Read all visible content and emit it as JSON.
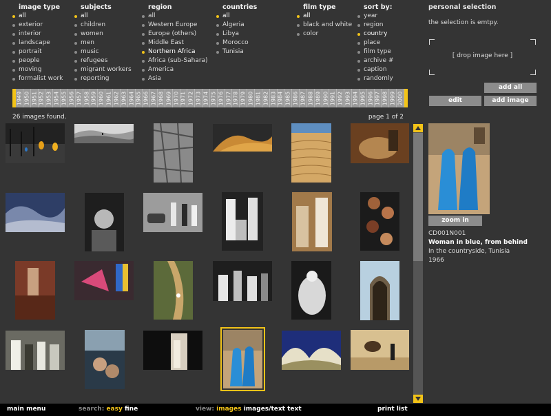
{
  "filters": [
    {
      "title": "image type",
      "items": [
        "all",
        "exterior",
        "interior",
        "landscape",
        "portrait",
        "people",
        "moving",
        "formalist work"
      ],
      "selected": [
        0
      ]
    },
    {
      "title": "subjects",
      "items": [
        "all",
        "children",
        "women",
        "men",
        "music",
        "refugees",
        "migrant workers",
        "reporting"
      ],
      "selected": [
        0
      ]
    },
    {
      "title": "region",
      "items": [
        "all",
        "Western Europe",
        "Europe (others)",
        "Middle East",
        "Northern Africa",
        "Africa (sub-Sahara)",
        "America",
        "Asia"
      ],
      "selected": [
        4
      ]
    },
    {
      "title": "countries",
      "items": [
        "all",
        "Algeria",
        "Libya",
        "Morocco",
        "Tunisia"
      ],
      "selected": [
        0
      ]
    },
    {
      "title": "film type",
      "items": [
        "all",
        "black and white",
        "color"
      ],
      "selected": [
        0
      ]
    },
    {
      "title": "sort by:",
      "items": [
        "year",
        "region",
        "country",
        "place",
        "film type",
        "archive #",
        "caption",
        "randomly"
      ],
      "selected": [
        2
      ]
    }
  ],
  "personal_selection": {
    "title": "personal selection",
    "empty_text": "the selection is emtpy.",
    "drop_label": "[ drop image here ]",
    "add_all": "add all",
    "edit": "edit",
    "add_image": "add image"
  },
  "years": [
    "1949",
    "1950",
    "1951",
    "1952",
    "1953",
    "1954",
    "1955",
    "1956",
    "1957",
    "1958",
    "1959",
    "1960",
    "1961",
    "1962",
    "1963",
    "1964",
    "1965",
    "1966",
    "1967",
    "1968",
    "1969",
    "1970",
    "1971",
    "1972",
    "1973",
    "1974",
    "1975",
    "1976",
    "1977",
    "1978",
    "1979",
    "1980",
    "1981",
    "1982",
    "1983",
    "1984",
    "1985",
    "1986",
    "1987",
    "1988",
    "1989",
    "1990",
    "1991",
    "1992",
    "1993",
    "1994",
    "1995",
    "1996",
    "1997",
    "1998",
    "1999",
    "2000"
  ],
  "results": {
    "count_text": "26 images found.",
    "page_text": "page 1 of 2"
  },
  "preview": {
    "zoom": "zoom in",
    "id": "CD001N001",
    "title": "Woman in blue, from behind",
    "place": "In the countryside, Tunisia",
    "year": "1966"
  },
  "footer": {
    "main_menu": "main menu",
    "search_label": "search:",
    "search_easy": "easy",
    "search_fine": "fine",
    "view_label": "view:",
    "view_images": "images",
    "view_images_text": "images/text",
    "view_text": "text",
    "print_list": "print list"
  },
  "colors": {
    "accent": "#f2c318",
    "background": "#343434",
    "button": "#8c8c8c"
  }
}
